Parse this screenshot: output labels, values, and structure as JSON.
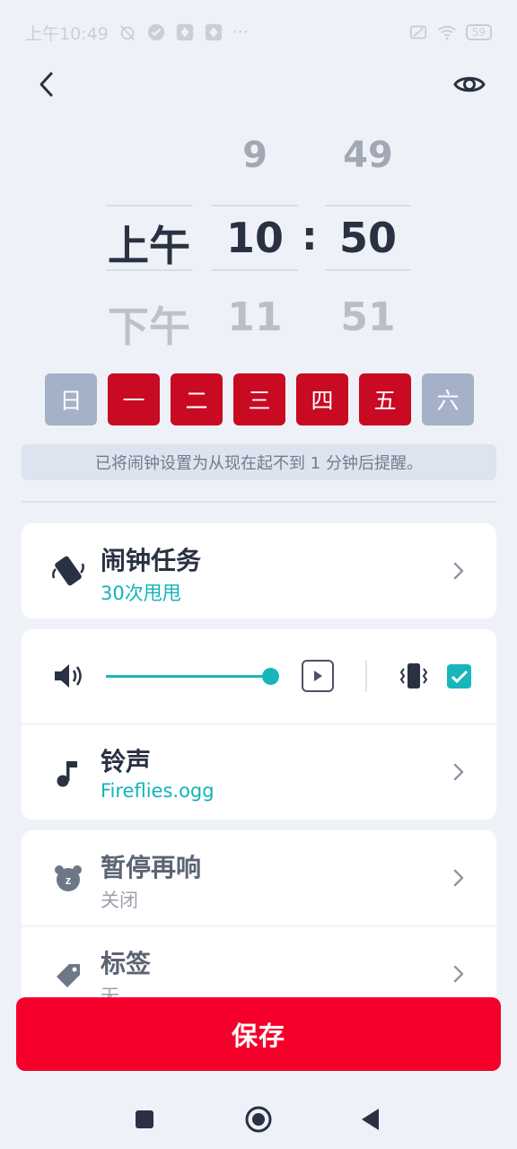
{
  "status_bar": {
    "time": "上午10:49",
    "dots": "···",
    "battery": "59"
  },
  "picker": {
    "ampm": {
      "above": "",
      "selected": "上午",
      "below": "下午"
    },
    "hour": {
      "above": "9",
      "selected": "10",
      "below": "11"
    },
    "separator": ":",
    "minute": {
      "above": "49",
      "selected": "50",
      "below": "51"
    }
  },
  "days": [
    {
      "label": "日",
      "selected": false
    },
    {
      "label": "一",
      "selected": true
    },
    {
      "label": "二",
      "selected": true
    },
    {
      "label": "三",
      "selected": true
    },
    {
      "label": "四",
      "selected": true
    },
    {
      "label": "五",
      "selected": true
    },
    {
      "label": "六",
      "selected": false
    }
  ],
  "info_text": "已将闹钟设置为从现在起不到 1 分钟后提醒。",
  "mission": {
    "title": "闹钟任务",
    "value": "30次甩甩"
  },
  "sound": {
    "volume_percent": 100,
    "vibrate_enabled": true,
    "ringtone_title": "铃声",
    "ringtone_value": "Fireflies.ogg"
  },
  "snooze": {
    "title": "暂停再响",
    "value": "关闭"
  },
  "label": {
    "title": "标签",
    "value": "无"
  },
  "save_label": "保存",
  "colors": {
    "accent": "#12B3B9",
    "day_selected": "#C80A23",
    "day_unselected": "#A4B1C7",
    "save": "#F5002A"
  }
}
